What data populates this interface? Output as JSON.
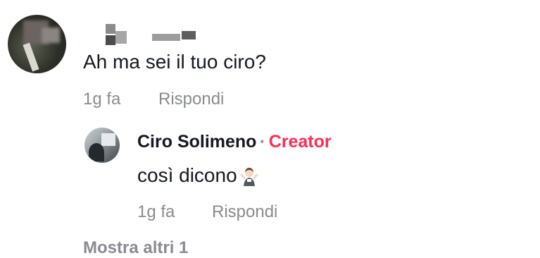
{
  "comments": [
    {
      "text": "Ah ma sei il tuo ciro?",
      "time": "1g fa",
      "reply_label": "Rispondi",
      "reply": {
        "author": "Ciro Solimeno",
        "separator": "·",
        "badge": "Creator",
        "badge_color": "#fe2c55",
        "text": "così dicono",
        "emoji": "person-shrugging-icon",
        "time": "1g fa",
        "reply_label": "Rispondi"
      }
    }
  ],
  "more_replies_partial": "Mostra altri 1"
}
